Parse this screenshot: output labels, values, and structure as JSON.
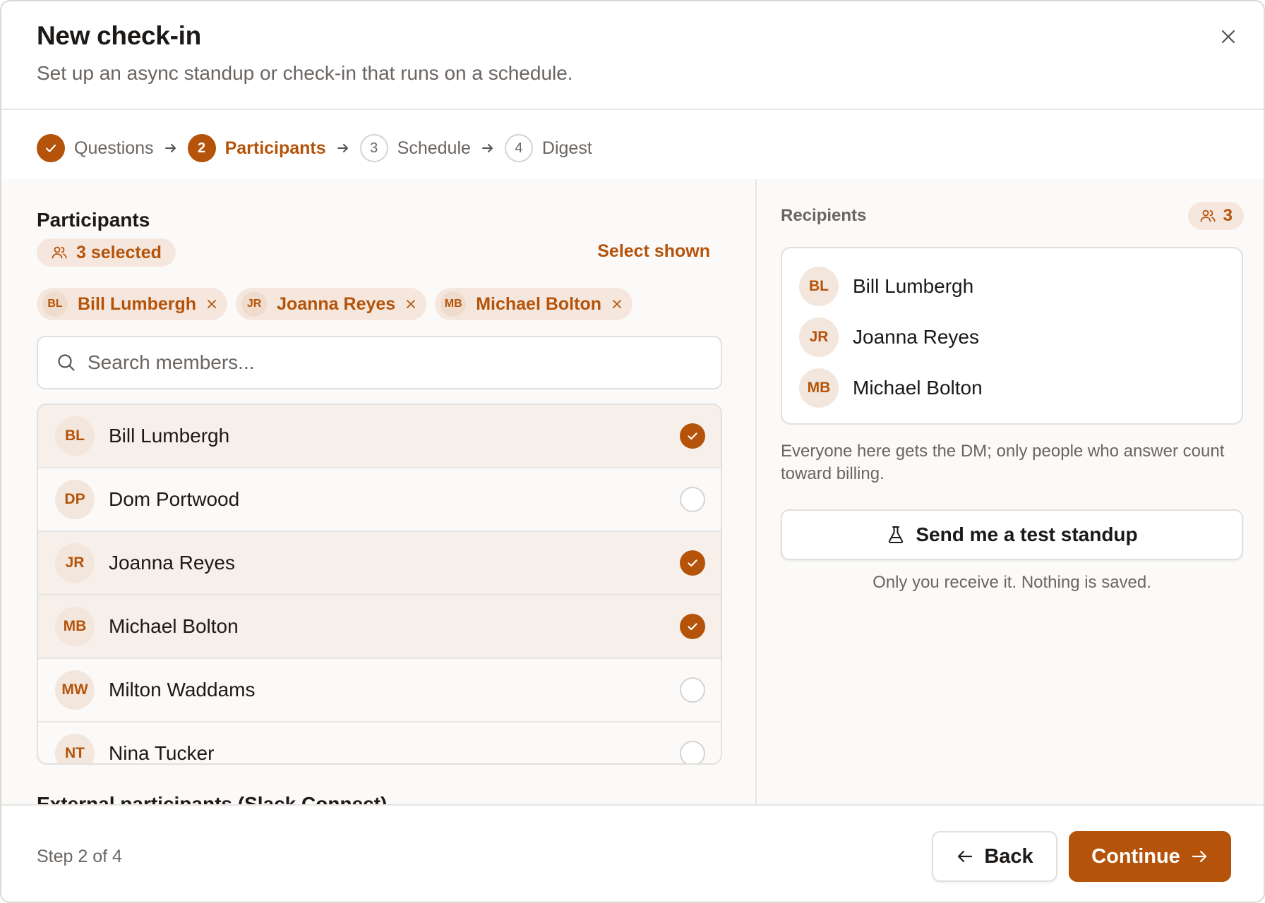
{
  "dialog": {
    "title": "New check-in",
    "subtitle": "Set up an async standup or check-in that runs on a schedule."
  },
  "stepper": {
    "steps": [
      {
        "number": "",
        "label": "Questions",
        "state": "done"
      },
      {
        "number": "2",
        "label": "Participants",
        "state": "active"
      },
      {
        "number": "3",
        "label": "Schedule",
        "state": "todo"
      },
      {
        "number": "4",
        "label": "Digest",
        "state": "todo"
      }
    ]
  },
  "participants": {
    "title": "Participants",
    "selected_text": "3 selected",
    "select_shown_label": "Select shown",
    "chips": [
      {
        "initials": "BL",
        "name": "Bill Lumbergh"
      },
      {
        "initials": "JR",
        "name": "Joanna Reyes"
      },
      {
        "initials": "MB",
        "name": "Michael Bolton"
      }
    ],
    "search_placeholder": "Search members...",
    "members": [
      {
        "initials": "BL",
        "name": "Bill Lumbergh",
        "selected": true
      },
      {
        "initials": "DP",
        "name": "Dom Portwood",
        "selected": false
      },
      {
        "initials": "JR",
        "name": "Joanna Reyes",
        "selected": true
      },
      {
        "initials": "MB",
        "name": "Michael Bolton",
        "selected": true
      },
      {
        "initials": "MW",
        "name": "Milton Waddams",
        "selected": false
      },
      {
        "initials": "NT",
        "name": "Nina Tucker",
        "selected": false
      }
    ],
    "external_title": "External participants (Slack Connect)"
  },
  "recipients": {
    "label": "Recipients",
    "count": "3",
    "list": [
      {
        "initials": "BL",
        "name": "Bill Lumbergh"
      },
      {
        "initials": "JR",
        "name": "Joanna Reyes"
      },
      {
        "initials": "MB",
        "name": "Michael Bolton"
      }
    ],
    "billing_note": "Everyone here gets the DM; only people who answer count toward billing.",
    "test_button_label": "Send me a test standup",
    "test_note": "Only you receive it. Nothing is saved."
  },
  "footer": {
    "step_counter": "Step 2 of 4",
    "back_label": "Back",
    "continue_label": "Continue"
  },
  "colors": {
    "accent": "#b45309",
    "accent_soft": "#f5e7dd",
    "text_primary": "#1c1917",
    "text_muted": "#6b6561",
    "border": "#e2e0dd"
  }
}
